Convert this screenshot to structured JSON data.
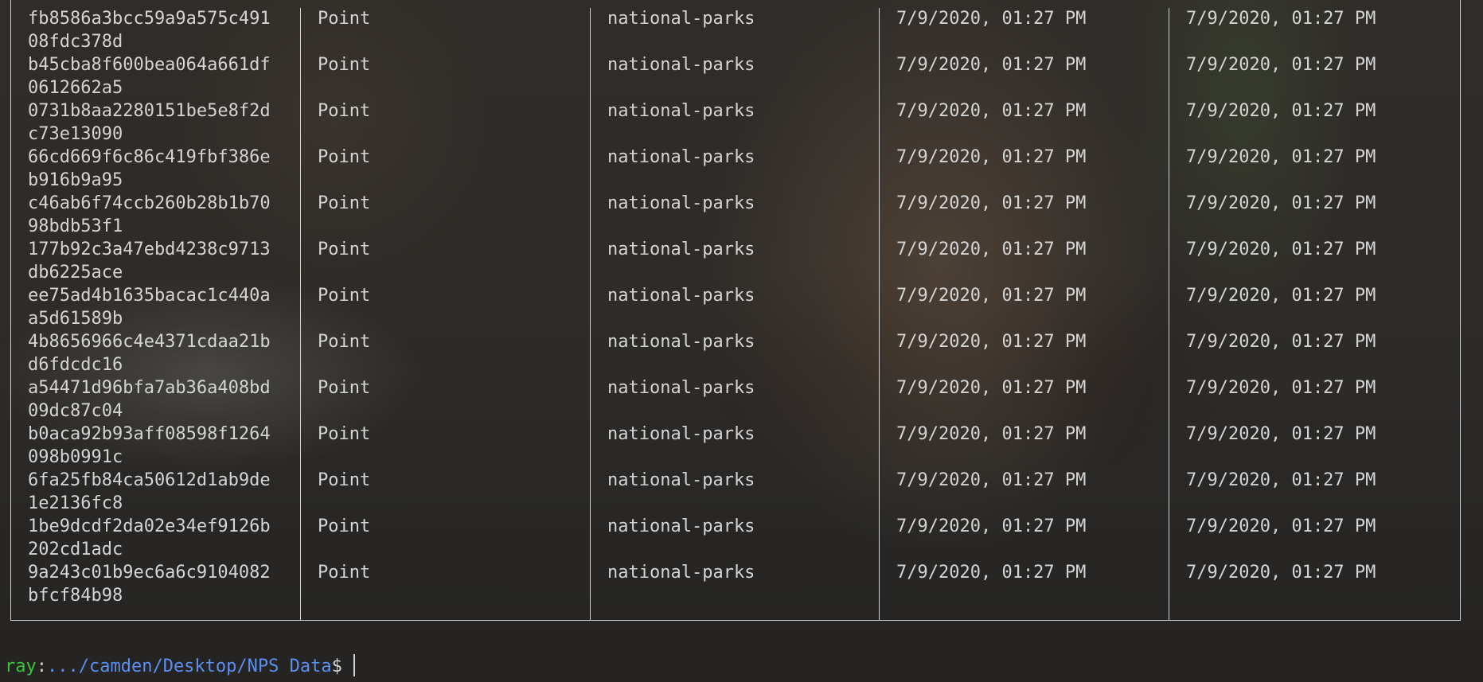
{
  "terminal": {
    "rows": [
      {
        "id_line1": "fb8586a3bcc59a9a575c491",
        "id_line2": "08fdc378d",
        "type": "Point",
        "source": "national-parks",
        "created": "7/9/2020, 01:27 PM",
        "updated": "7/9/2020, 01:27 PM"
      },
      {
        "id_line1": "b45cba8f600bea064a661df",
        "id_line2": "0612662a5",
        "type": "Point",
        "source": "national-parks",
        "created": "7/9/2020, 01:27 PM",
        "updated": "7/9/2020, 01:27 PM"
      },
      {
        "id_line1": "0731b8aa2280151be5e8f2d",
        "id_line2": "c73e13090",
        "type": "Point",
        "source": "national-parks",
        "created": "7/9/2020, 01:27 PM",
        "updated": "7/9/2020, 01:27 PM"
      },
      {
        "id_line1": "66cd669f6c86c419fbf386e",
        "id_line2": "b916b9a95",
        "type": "Point",
        "source": "national-parks",
        "created": "7/9/2020, 01:27 PM",
        "updated": "7/9/2020, 01:27 PM"
      },
      {
        "id_line1": "c46ab6f74ccb260b28b1b70",
        "id_line2": "98bdb53f1",
        "type": "Point",
        "source": "national-parks",
        "created": "7/9/2020, 01:27 PM",
        "updated": "7/9/2020, 01:27 PM"
      },
      {
        "id_line1": "177b92c3a47ebd4238c9713",
        "id_line2": "db6225ace",
        "type": "Point",
        "source": "national-parks",
        "created": "7/9/2020, 01:27 PM",
        "updated": "7/9/2020, 01:27 PM"
      },
      {
        "id_line1": "ee75ad4b1635bacac1c440a",
        "id_line2": "a5d61589b",
        "type": "Point",
        "source": "national-parks",
        "created": "7/9/2020, 01:27 PM",
        "updated": "7/9/2020, 01:27 PM"
      },
      {
        "id_line1": "4b8656966c4e4371cdaa21b",
        "id_line2": "d6fdcdc16",
        "type": "Point",
        "source": "national-parks",
        "created": "7/9/2020, 01:27 PM",
        "updated": "7/9/2020, 01:27 PM"
      },
      {
        "id_line1": "a54471d96bfa7ab36a408bd",
        "id_line2": "09dc87c04",
        "type": "Point",
        "source": "national-parks",
        "created": "7/9/2020, 01:27 PM",
        "updated": "7/9/2020, 01:27 PM"
      },
      {
        "id_line1": "b0aca92b93aff08598f1264",
        "id_line2": "098b0991c",
        "type": "Point",
        "source": "national-parks",
        "created": "7/9/2020, 01:27 PM",
        "updated": "7/9/2020, 01:27 PM"
      },
      {
        "id_line1": "6fa25fb84ca50612d1ab9de",
        "id_line2": "1e2136fc8",
        "type": "Point",
        "source": "national-parks",
        "created": "7/9/2020, 01:27 PM",
        "updated": "7/9/2020, 01:27 PM"
      },
      {
        "id_line1": "1be9dcdf2da02e34ef9126b",
        "id_line2": "202cd1adc",
        "type": "Point",
        "source": "national-parks",
        "created": "7/9/2020, 01:27 PM",
        "updated": "7/9/2020, 01:27 PM"
      },
      {
        "id_line1": "9a243c01b9ec6a6c9104082",
        "id_line2": "bfcf84b98",
        "type": "Point",
        "source": "national-parks",
        "created": "7/9/2020, 01:27 PM",
        "updated": "7/9/2020, 01:27 PM"
      }
    ]
  },
  "prompt": {
    "user": "ray",
    "separator": ":",
    "path": ".../camden/Desktop/NPS Data",
    "symbol": "$"
  },
  "colors": {
    "user": "#3cc33c",
    "path": "#5b8ef0",
    "text": "#d4d4d4",
    "border": "#d0d0d0"
  }
}
